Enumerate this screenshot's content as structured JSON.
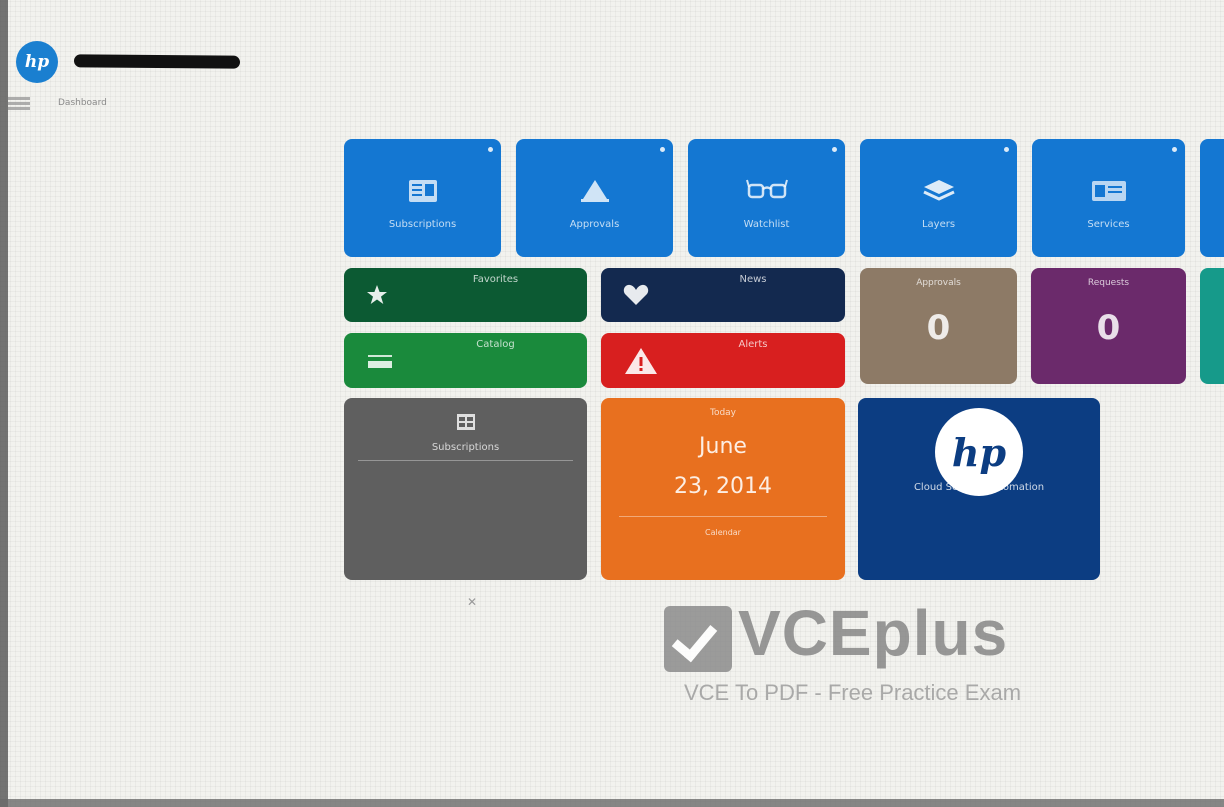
{
  "header": {
    "logo_text": "hp",
    "breadcrumb": "Dashboard"
  },
  "tiles_top": [
    {
      "label": "Subscriptions",
      "icon": "catalog-icon"
    },
    {
      "label": "Approvals",
      "icon": "alert-icon"
    },
    {
      "label": "Watchlist",
      "icon": "glasses-icon"
    },
    {
      "label": "Layers",
      "icon": "layers-icon"
    },
    {
      "label": "Services",
      "icon": "card-icon"
    }
  ],
  "bars": {
    "favorites": "Favorites",
    "news": "News",
    "catalog": "Catalog",
    "alert": "Alerts"
  },
  "counters": [
    {
      "label": "Approvals",
      "value": "0"
    },
    {
      "label": "Requests",
      "value": "0"
    }
  ],
  "gray_tile": {
    "label": "Subscriptions"
  },
  "date_tile": {
    "header": "Today",
    "month": "June",
    "day": "23, 2014",
    "footer": "Calendar"
  },
  "hp_tile": {
    "logo_text": "hp",
    "label": "Cloud Service Automation"
  },
  "watermark": {
    "brand": "VCEplus",
    "tagline": "VCE To PDF - Free Practice Exam"
  },
  "colors": {
    "blue": "#1477d2",
    "dark_green": "#0c5a33",
    "navy": "#13294f",
    "taupe": "#8d7a66",
    "purple": "#6b2a6b",
    "green": "#1a8a3c",
    "red": "#d81f1f",
    "gray": "#5f5f5f",
    "orange": "#e8701f",
    "hp_navy": "#0c3d82",
    "teal": "#169a8a"
  }
}
